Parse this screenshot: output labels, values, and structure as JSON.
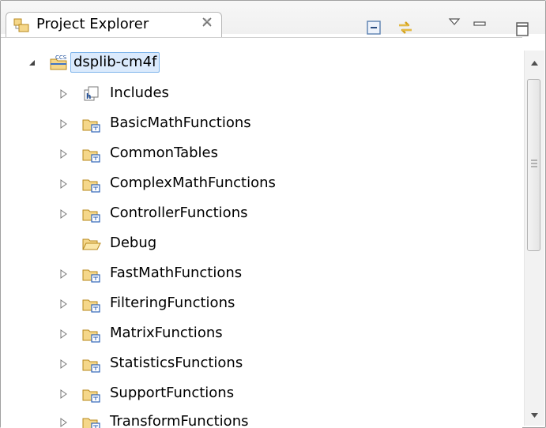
{
  "view": {
    "tab_title": "Project Explorer",
    "tab_icon": "project-explorer-icon",
    "close_icon": "close-tab-icon",
    "toolbar": [
      "collapse-all-icon",
      "link-with-editor-icon",
      "view-menu-icon",
      "minimize-icon",
      "maximize-icon"
    ]
  },
  "tree": {
    "root": {
      "label": "dsplib-cm4f",
      "icon": "ccs-project-icon",
      "expanded": true
    },
    "items": [
      {
        "label": "Includes",
        "icon": "includes-icon",
        "expandable": true
      },
      {
        "label": "BasicMathFunctions",
        "icon": "source-folder-icon",
        "expandable": true
      },
      {
        "label": "CommonTables",
        "icon": "source-folder-icon",
        "expandable": true
      },
      {
        "label": "ComplexMathFunctions",
        "icon": "source-folder-icon",
        "expandable": true
      },
      {
        "label": "ControllerFunctions",
        "icon": "source-folder-icon",
        "expandable": true
      },
      {
        "label": "Debug",
        "icon": "folder-icon",
        "expandable": false
      },
      {
        "label": "FastMathFunctions",
        "icon": "source-folder-icon",
        "expandable": true
      },
      {
        "label": "FilteringFunctions",
        "icon": "source-folder-icon",
        "expandable": true
      },
      {
        "label": "MatrixFunctions",
        "icon": "source-folder-icon",
        "expandable": true
      },
      {
        "label": "StatisticsFunctions",
        "icon": "source-folder-icon",
        "expandable": true
      },
      {
        "label": "SupportFunctions",
        "icon": "source-folder-icon",
        "expandable": true
      },
      {
        "label": "TransformFunctions",
        "icon": "source-folder-icon",
        "expandable": true
      }
    ]
  },
  "colors": {
    "selection_border": "#7eb4ea",
    "selection_fill": "#dbeafc",
    "folder_fill": "#f5d78a",
    "folder_stroke": "#b88a1e"
  }
}
